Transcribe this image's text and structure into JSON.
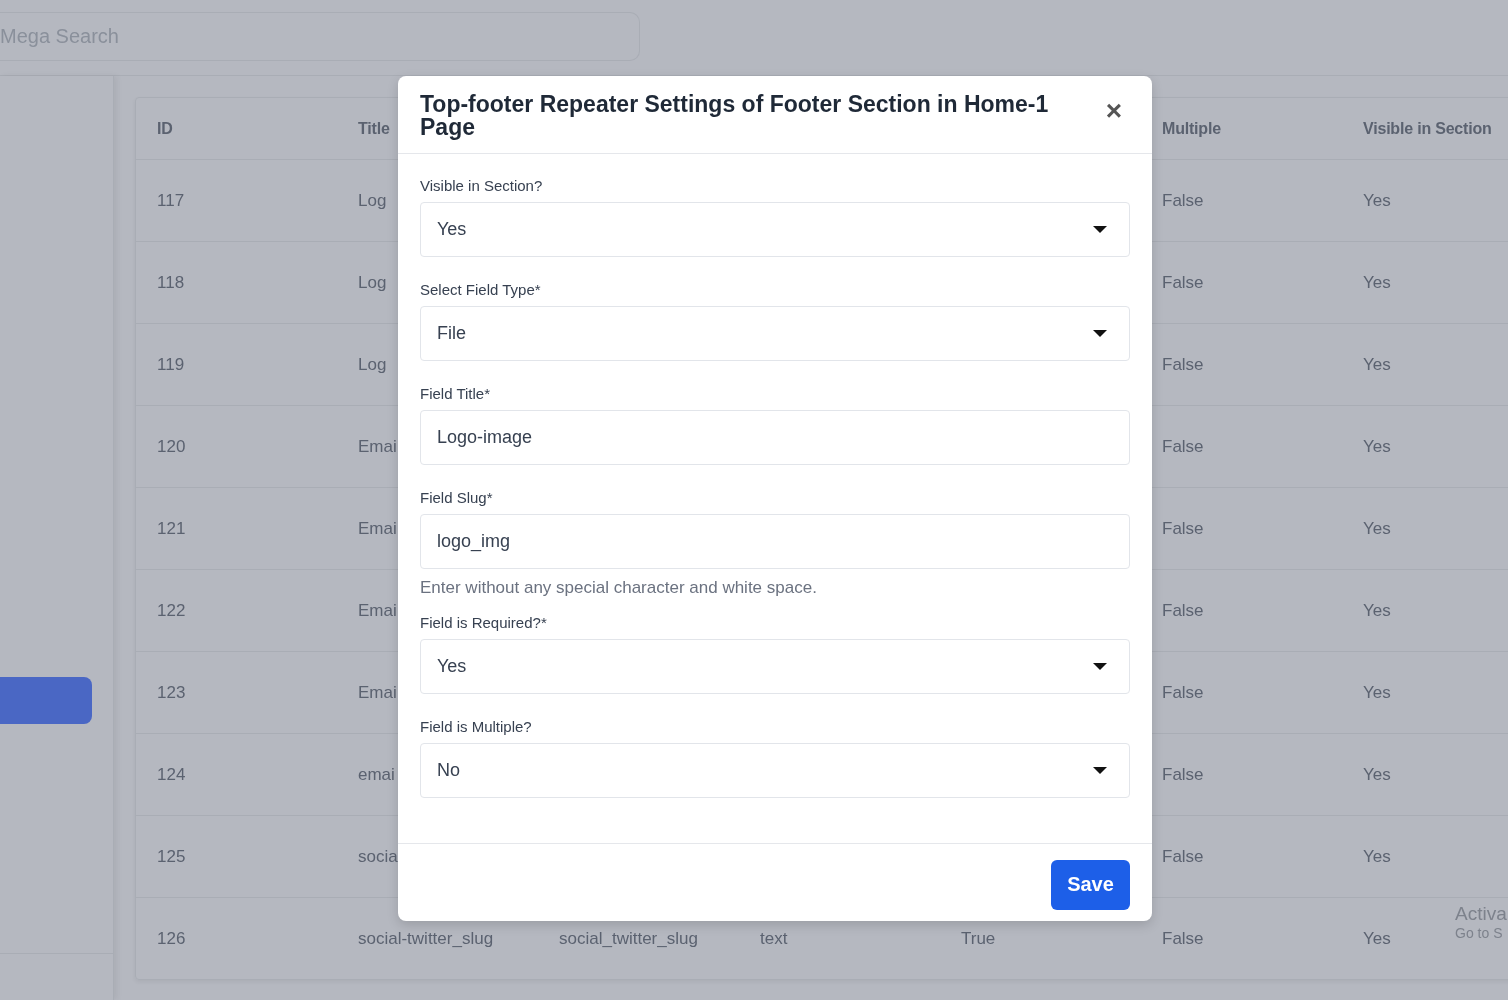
{
  "search": {
    "placeholder": "Mega Search"
  },
  "table": {
    "header": {
      "id": "ID",
      "title": "Title",
      "multiple": "Multiple",
      "visible": "Visible in Section"
    },
    "rows": [
      {
        "id": "117",
        "title": "Log",
        "multiple": "False",
        "visible": "Yes"
      },
      {
        "id": "118",
        "title": "Log",
        "multiple": "False",
        "visible": "Yes"
      },
      {
        "id": "119",
        "title": "Log",
        "multiple": "False",
        "visible": "Yes"
      },
      {
        "id": "120",
        "title": "Emai",
        "multiple": "False",
        "visible": "Yes"
      },
      {
        "id": "121",
        "title": "Emai",
        "multiple": "False",
        "visible": "Yes"
      },
      {
        "id": "122",
        "title": "Emai",
        "multiple": "False",
        "visible": "Yes"
      },
      {
        "id": "123",
        "title": "Emai",
        "multiple": "False",
        "visible": "Yes"
      },
      {
        "id": "124",
        "title": "emai",
        "multiple": "False",
        "visible": "Yes"
      },
      {
        "id": "125",
        "title": "socia",
        "multiple": "False",
        "visible": "Yes"
      },
      {
        "id": "126",
        "title": "social-twitter_slug",
        "column_3": "social_twitter_slug",
        "column_4": "text",
        "column_5": "True",
        "multiple": "False",
        "visible": "Yes"
      }
    ]
  },
  "modal": {
    "title": "Top-footer Repeater Settings of Footer Section in Home-1 Page",
    "close": "×",
    "fields": [
      {
        "kind": "select",
        "label": "Visible in Section?",
        "value": "Yes"
      },
      {
        "kind": "select",
        "label": "Select Field Type",
        "mark": "*",
        "value": "File"
      },
      {
        "kind": "input",
        "label": "Field Title",
        "mark": "*",
        "value": "Logo-image"
      },
      {
        "kind": "input",
        "label": "Field Slug",
        "mark": "*",
        "value": "logo_img",
        "help": "Enter without any special character and white space."
      },
      {
        "kind": "select",
        "label": "Field is Required?",
        "mark": "*",
        "value": "Yes"
      },
      {
        "kind": "select",
        "label": "Field is Multiple?",
        "value": "No"
      }
    ],
    "save": "Save"
  },
  "os_notice": {
    "line_1": "Activa",
    "line_2": "Go to S"
  }
}
